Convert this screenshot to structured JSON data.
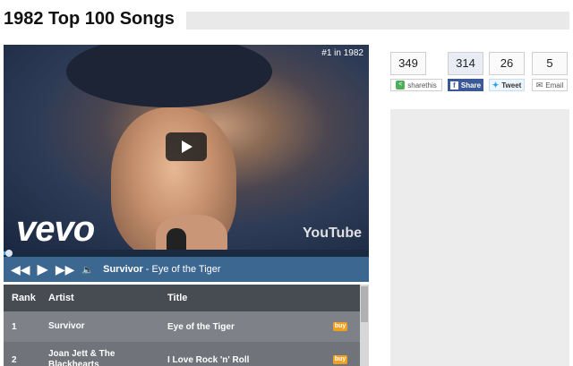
{
  "header": {
    "title": "1982 Top 100 Songs"
  },
  "video": {
    "rank_tag": "#1 in 1982",
    "vevo": "vevo",
    "youtube": "YouTube",
    "progress_fraction": 0.005
  },
  "player": {
    "artist": "Survivor",
    "separator": " - ",
    "song": "Eye of the Tiger"
  },
  "table": {
    "headers": {
      "rank": "Rank",
      "artist": "Artist",
      "title": "Title"
    },
    "rows": [
      {
        "rank": "1",
        "artist": "Survivor",
        "title": "Eye of the Tiger",
        "buy": "buy"
      },
      {
        "rank": "2",
        "artist": "Joan Jett & The Blackhearts",
        "title": "I Love Rock 'n' Roll",
        "buy": "buy"
      }
    ]
  },
  "share": {
    "sharethis": {
      "count": "349",
      "label": "sharethis"
    },
    "facebook": {
      "count": "314",
      "label": "Share"
    },
    "twitter": {
      "count": "26",
      "label": "Tweet"
    },
    "email": {
      "count": "5",
      "label": "Email"
    }
  },
  "colors": {
    "accent": "#3b6790",
    "facebook": "#3b5998",
    "buy": "#f0a020"
  }
}
